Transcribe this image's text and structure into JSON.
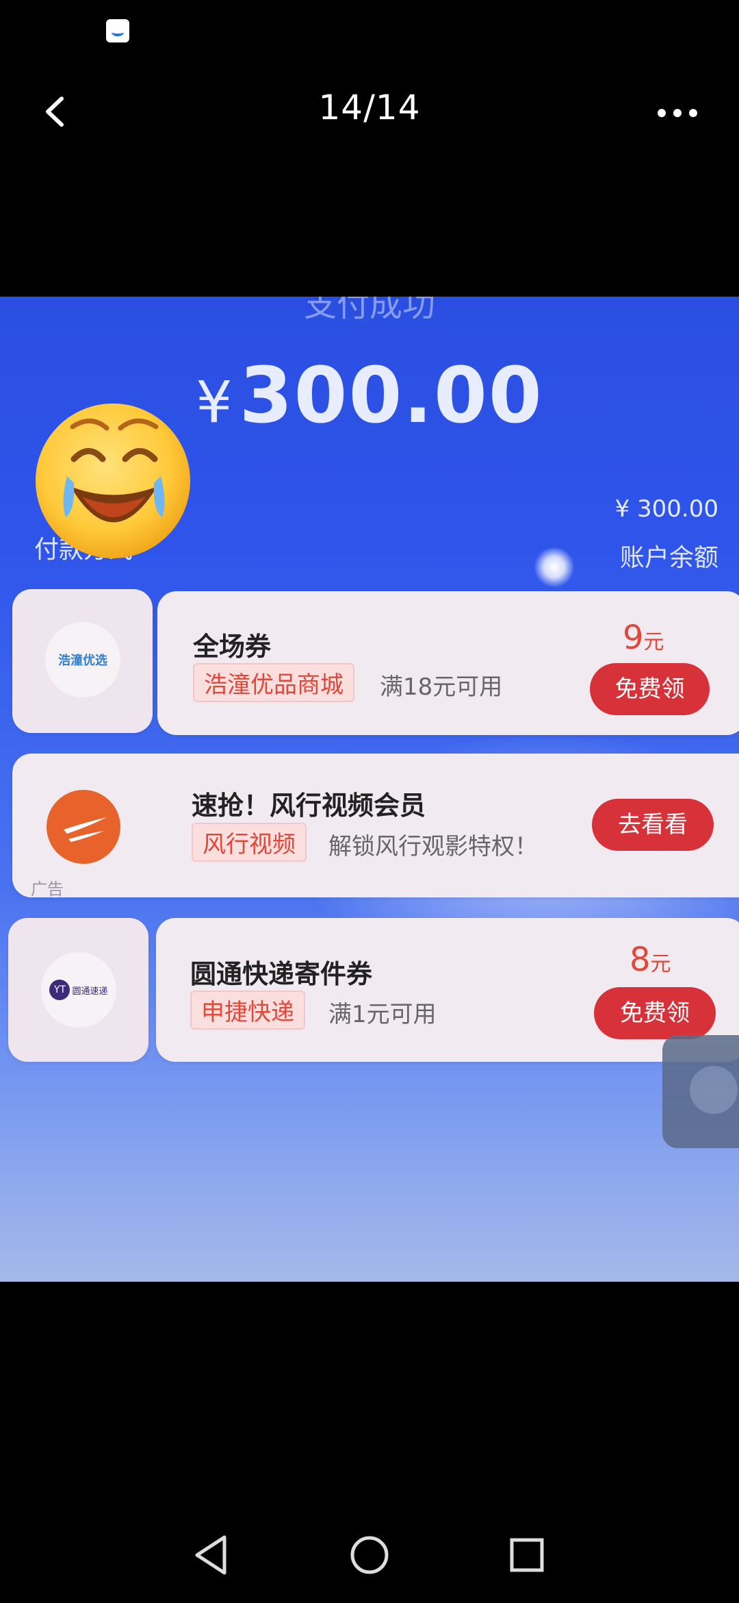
{
  "viewer": {
    "page_counter": "14/14",
    "back_icon": "chevron-left-icon",
    "more_icon": "more-horizontal-icon"
  },
  "receipt": {
    "status": "支付成功",
    "currency": "¥",
    "amount": "300.00",
    "balance_value": "¥ 300.00",
    "balance_label": "账户余额",
    "pay_label": "付款方式"
  },
  "offers": [
    {
      "title": "全场券",
      "merchant_tag": "浩潼优品商城",
      "condition": "满18元可用",
      "price_number": "9",
      "price_unit": "元",
      "button": "免费领",
      "logo_text": "浩潼优选"
    },
    {
      "title": "速抢！风行视频会员",
      "merchant_tag": "风行视频",
      "condition": "解锁风行观影特权！",
      "button": "去看看",
      "ad_label": "广告"
    },
    {
      "title": "圆通快递寄件券",
      "merchant_tag": "申捷快递",
      "condition": "满1元可用",
      "price_number": "8",
      "price_unit": "元",
      "button": "免费领",
      "logo_text": "圆通速递"
    }
  ],
  "colors": {
    "accent_red": "#d7323a",
    "photo_blue": "#2f54ea"
  }
}
